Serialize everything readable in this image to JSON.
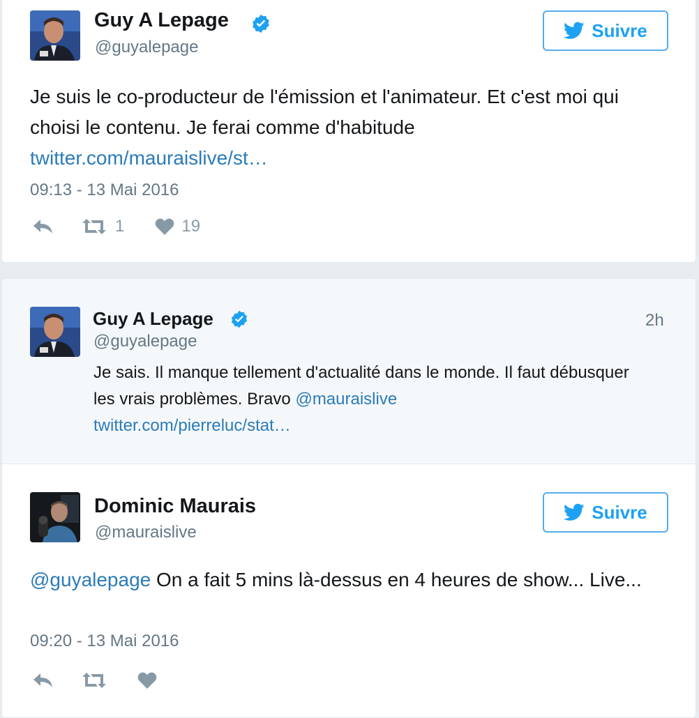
{
  "colors": {
    "link": "#2b7bb9",
    "follow_border": "#55acee",
    "follow_text": "#1da1f2",
    "verified": "#1da1f2",
    "muted": "#657786",
    "action_icon": "#8899a6",
    "reply_bg": "#f5f8fa"
  },
  "tweet1": {
    "name": "Guy A Lepage",
    "handle": "@guyalepage",
    "verified_icon": "verified-badge-icon",
    "follow_label": "Suivre",
    "text_main": "Je suis le co-producteur de l'émission et l'animateur. Et c'est moi qui choisi le contenu. Je ferai comme d'habitude",
    "link": "twitter.com/mauraislive/st…",
    "timestamp": "09:13 - 13 Mai 2016",
    "retweets": "1",
    "likes": "19"
  },
  "reply": {
    "name": "Guy A Lepage",
    "handle": "@guyalepage",
    "age": "2h",
    "text_main": "Je sais. Il manque tellement d'actualité dans le monde. Il faut débusquer les vrais problèmes. Bravo",
    "mention": "@mauraislive",
    "link": "twitter.com/pierreluc/stat…"
  },
  "tweet2": {
    "name": "Dominic Maurais",
    "handle": "@mauraislive",
    "follow_label": "Suivre",
    "mention": "@guyalepage",
    "text_main": "On a fait 5 mins là-dessus en 4 heures de show... Live...",
    "timestamp": "09:20 - 13 Mai 2016"
  }
}
